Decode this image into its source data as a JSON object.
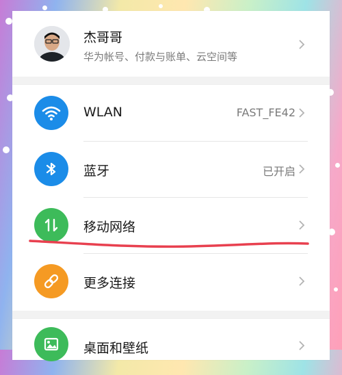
{
  "profile": {
    "name": "杰哥哥",
    "subtitle": "华为帐号、付款与账单、云空间等"
  },
  "rows": [
    {
      "label": "WLAN",
      "value": "FAST_FE42",
      "icon": "wifi-icon",
      "color": "#1b8ce8"
    },
    {
      "label": "蓝牙",
      "value": "已开启",
      "icon": "bluetooth-icon",
      "color": "#1b8ce8"
    },
    {
      "label": "移动网络",
      "value": "",
      "icon": "mobile-data-icon",
      "color": "#3dbb5a"
    },
    {
      "label": "更多连接",
      "value": "",
      "icon": "link-icon",
      "color": "#f59a23"
    },
    {
      "label": "桌面和壁纸",
      "value": "",
      "icon": "wallpaper-icon",
      "color": "#3dbb5a"
    }
  ],
  "colors": {
    "annotation_underline": "#e8404f",
    "chevron": "#b3b3b3"
  }
}
